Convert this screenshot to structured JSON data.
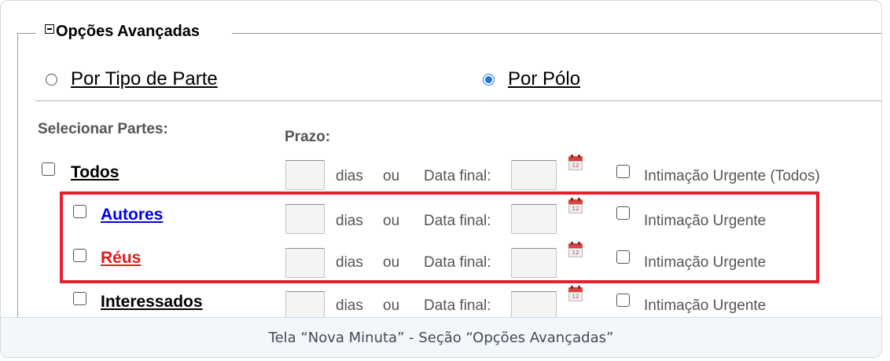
{
  "legend": {
    "title": "Opções Avançadas"
  },
  "mode": {
    "options": [
      {
        "label": "Por Tipo de Parte",
        "checked": false
      },
      {
        "label": "Por Pólo",
        "checked": true
      }
    ]
  },
  "headers": {
    "parties": "Selecionar Partes:",
    "deadline": "Prazo:"
  },
  "labels": {
    "days": "dias",
    "or": "ou",
    "final_date": "Data final:"
  },
  "calendar_icon_text": "12",
  "rows": [
    {
      "party": "Todos",
      "party_color": "#000000",
      "urgent": "Intimação Urgente (Todos)"
    },
    {
      "party": "Autores",
      "party_color": "#0000ee",
      "urgent": "Intimação Urgente"
    },
    {
      "party": "Réus",
      "party_color": "#e01b1b",
      "urgent": "Intimação Urgente"
    },
    {
      "party": "Interessados",
      "party_color": "#000000",
      "urgent": "Intimação Urgente"
    }
  ],
  "caption": "Tela “Nova Minuta” - Seção “Opções Avançadas”",
  "colors": {
    "highlight": "#e4212f",
    "radio_selected": "#1a73e8"
  }
}
